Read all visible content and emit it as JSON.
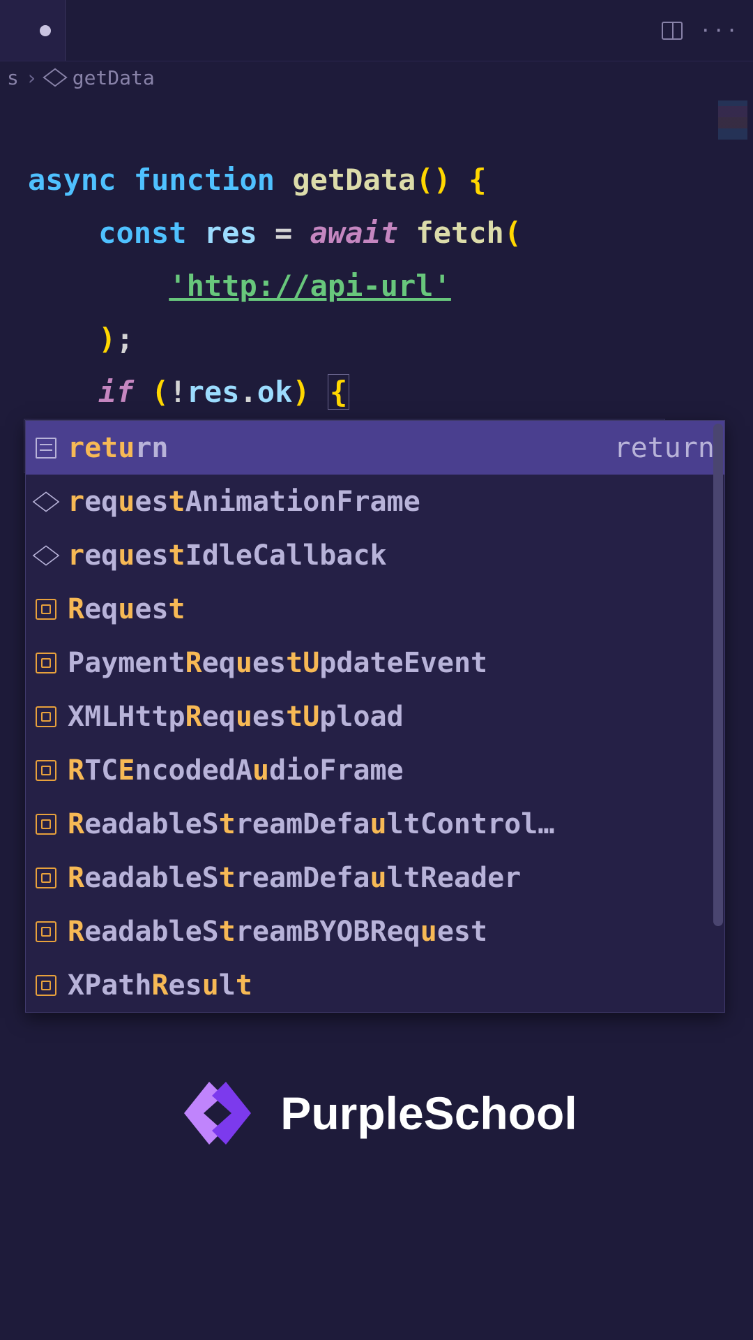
{
  "breadcrumb": {
    "prefix": "s",
    "symbol": "getData"
  },
  "code": {
    "async": "async",
    "function": "function",
    "fn_name": "getData",
    "const": "const",
    "res": "res",
    "await": "await",
    "fetch": "fetch",
    "url": "'http://api-url'",
    "if": "if",
    "ok": "ok",
    "partial": "retu"
  },
  "autocomplete": {
    "items": [
      {
        "icon": "keyword",
        "segments": [
          {
            "t": "retu",
            "h": true
          },
          {
            "t": "rn",
            "h": false
          }
        ],
        "detail": "return"
      },
      {
        "icon": "module",
        "segments": [
          {
            "t": "r",
            "h": true
          },
          {
            "t": "eq",
            "h": false
          },
          {
            "t": "u",
            "h": true
          },
          {
            "t": "es",
            "h": false
          },
          {
            "t": "t",
            "h": true
          },
          {
            "t": "AnimationFrame",
            "h": false
          }
        ]
      },
      {
        "icon": "module",
        "segments": [
          {
            "t": "r",
            "h": true
          },
          {
            "t": "eq",
            "h": false
          },
          {
            "t": "u",
            "h": true
          },
          {
            "t": "es",
            "h": false
          },
          {
            "t": "t",
            "h": true
          },
          {
            "t": "IdleCallback",
            "h": false
          }
        ]
      },
      {
        "icon": "class",
        "segments": [
          {
            "t": "R",
            "h": true
          },
          {
            "t": "eq",
            "h": false
          },
          {
            "t": "u",
            "h": true
          },
          {
            "t": "es",
            "h": false
          },
          {
            "t": "t",
            "h": true
          }
        ]
      },
      {
        "icon": "class",
        "segments": [
          {
            "t": "Payment",
            "h": false
          },
          {
            "t": "R",
            "h": true
          },
          {
            "t": "eq",
            "h": false
          },
          {
            "t": "u",
            "h": true
          },
          {
            "t": "es",
            "h": false
          },
          {
            "t": "t",
            "h": true
          },
          {
            "t": "U",
            "h": true
          },
          {
            "t": "pdateEvent",
            "h": false
          }
        ]
      },
      {
        "icon": "class",
        "segments": [
          {
            "t": "XMLHttp",
            "h": false
          },
          {
            "t": "R",
            "h": true
          },
          {
            "t": "eq",
            "h": false
          },
          {
            "t": "u",
            "h": true
          },
          {
            "t": "es",
            "h": false
          },
          {
            "t": "t",
            "h": true
          },
          {
            "t": "U",
            "h": true
          },
          {
            "t": "pload",
            "h": false
          }
        ]
      },
      {
        "icon": "class",
        "segments": [
          {
            "t": "R",
            "h": true
          },
          {
            "t": "TC",
            "h": false
          },
          {
            "t": "E",
            "h": true
          },
          {
            "t": "ncodedA",
            "h": false
          },
          {
            "t": "u",
            "h": true
          },
          {
            "t": "dioFrame",
            "h": false
          }
        ]
      },
      {
        "icon": "class",
        "segments": [
          {
            "t": "R",
            "h": true
          },
          {
            "t": "eadableS",
            "h": false
          },
          {
            "t": "t",
            "h": true
          },
          {
            "t": "reamDefa",
            "h": false
          },
          {
            "t": "u",
            "h": true
          },
          {
            "t": "ltControl…",
            "h": false
          }
        ]
      },
      {
        "icon": "class",
        "segments": [
          {
            "t": "R",
            "h": true
          },
          {
            "t": "eadableS",
            "h": false
          },
          {
            "t": "t",
            "h": true
          },
          {
            "t": "reamDefa",
            "h": false
          },
          {
            "t": "u",
            "h": true
          },
          {
            "t": "ltReader",
            "h": false
          }
        ]
      },
      {
        "icon": "class",
        "segments": [
          {
            "t": "R",
            "h": true
          },
          {
            "t": "eadableS",
            "h": false
          },
          {
            "t": "t",
            "h": true
          },
          {
            "t": "reamBYOBReq",
            "h": false
          },
          {
            "t": "u",
            "h": true
          },
          {
            "t": "est",
            "h": false
          }
        ]
      },
      {
        "icon": "class",
        "segments": [
          {
            "t": "XPath",
            "h": false
          },
          {
            "t": "R",
            "h": true
          },
          {
            "t": "es",
            "h": false
          },
          {
            "t": "u",
            "h": true
          },
          {
            "t": "l",
            "h": false
          },
          {
            "t": "t",
            "h": true
          }
        ]
      }
    ]
  },
  "brand": {
    "name": "PurpleSchool"
  }
}
